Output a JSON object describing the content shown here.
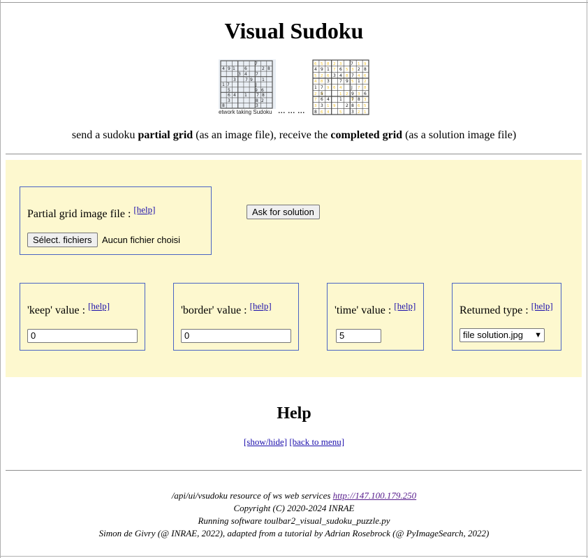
{
  "page": {
    "title": "Visual Sudoku",
    "image_caption": "etwork taking Sudoku",
    "dots": "... ... ...",
    "intro": {
      "part1": "send a sudoku ",
      "bold1": "partial grid",
      "part2": " (as an image file), receive the ",
      "bold2": "completed grid",
      "part3": " (as a solution image file)"
    }
  },
  "form": {
    "file_field": {
      "label": "Partial grid image file : ",
      "help": "[help]",
      "button": "Sélect. fichiers",
      "status": "Aucun fichier choisi"
    },
    "submit_label": "Ask for solution",
    "keep": {
      "label": "'keep' value : ",
      "help": "[help]",
      "value": "0"
    },
    "border": {
      "label": "'border' value : ",
      "help": "[help]",
      "value": "0"
    },
    "time": {
      "label": "'time' value : ",
      "help": "[help]",
      "value": "5"
    },
    "returned_type": {
      "label": "Returned type : ",
      "help": "[help]",
      "selected": "file solution.jpg"
    }
  },
  "help_section": {
    "title": "Help",
    "show_hide": "[show/hide]",
    "back_to_menu": "[back to menu]"
  },
  "footer": {
    "line1_text": "/api/ui/vsudoku resource of ws web services ",
    "line1_link": "http://147.100.179.250",
    "line2": "Copyright (C) 2020-2024 INRAE",
    "line3": "Running software toulbar2_visual_sudoku_puzzle.py",
    "line4": "Simon de Givry (@ INRAE, 2022), adapted from a tutorial by Adrian Rosebrock (@ PyImageSearch, 2022)"
  },
  "colors": {
    "panel_background": "#fdf8cf",
    "box_border": "#4a64c4",
    "link": "#1a0dab",
    "visited_link": "#551a8b",
    "solution_digit": "#f2c230"
  },
  "icons": {
    "partial_grid_image": "sudoku-partial-grid-photo",
    "solution_grid_image": "sudoku-solution-grid-image",
    "select_chevron": "chevron-down-icon"
  }
}
